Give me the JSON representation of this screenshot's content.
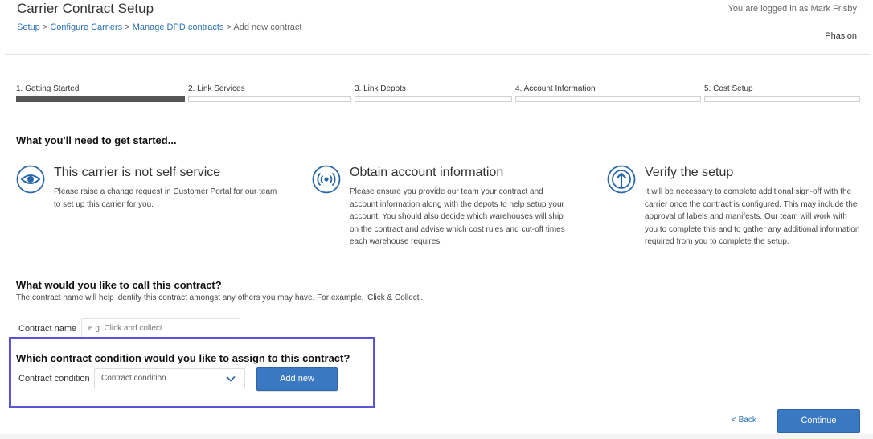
{
  "header": {
    "title": "Carrier Contract Setup",
    "breadcrumb": [
      {
        "label": "Setup"
      },
      {
        "label": "Configure Carriers"
      },
      {
        "label": "Manage DPD contracts"
      },
      {
        "label": "Add new contract"
      }
    ],
    "separator": ">",
    "logged_in_text": "You are logged in as Mark Frisby",
    "company": "Phasion"
  },
  "steps": [
    {
      "label": "1. Getting Started",
      "active": true
    },
    {
      "label": "2. Link Services",
      "active": false
    },
    {
      "label": "3. Link Depots",
      "active": false
    },
    {
      "label": "4. Account Information",
      "active": false
    },
    {
      "label": "5. Cost Setup",
      "active": false
    }
  ],
  "intro": {
    "heading": "What you'll need to get started...",
    "cards": [
      {
        "icon": "eye-icon",
        "title": "This carrier is not self service",
        "body": "Please raise a change request in Customer Portal for our team to set up this carrier for you."
      },
      {
        "icon": "broadcast-icon",
        "title": "Obtain account information",
        "body": "Please ensure you provide our team your contract and account information along with the depots to help setup your account. You should also decide which warehouses will ship on the contract and advise which cost rules and cut-off times each warehouse requires."
      },
      {
        "icon": "upload-arrow-icon",
        "title": "Verify the setup",
        "body": "It will be necessary to complete additional sign-off with the carrier once the contract is configured. This may include the approval of labels and manifests. Our team will work with you to complete this and to gather any additional information required from you to complete the setup."
      }
    ]
  },
  "contract_name": {
    "heading": "What would you like to call this contract?",
    "description": "The contract name will help identify this contract amongst any others you may have. For example, 'Click & Collect'.",
    "label": "Contract name",
    "placeholder": "e.g. Click and collect",
    "value": ""
  },
  "contract_condition": {
    "heading": "Which contract condition would you like to assign to this contract?",
    "label": "Contract condition",
    "selected": "Contract condition",
    "add_new_label": "Add new"
  },
  "footer": {
    "back_label": "< Back",
    "continue_label": "Continue"
  },
  "colors": {
    "accent": "#3a78c2",
    "link": "#2a6fb5",
    "highlight_border": "#5b55d6",
    "active_step": "#555555"
  }
}
